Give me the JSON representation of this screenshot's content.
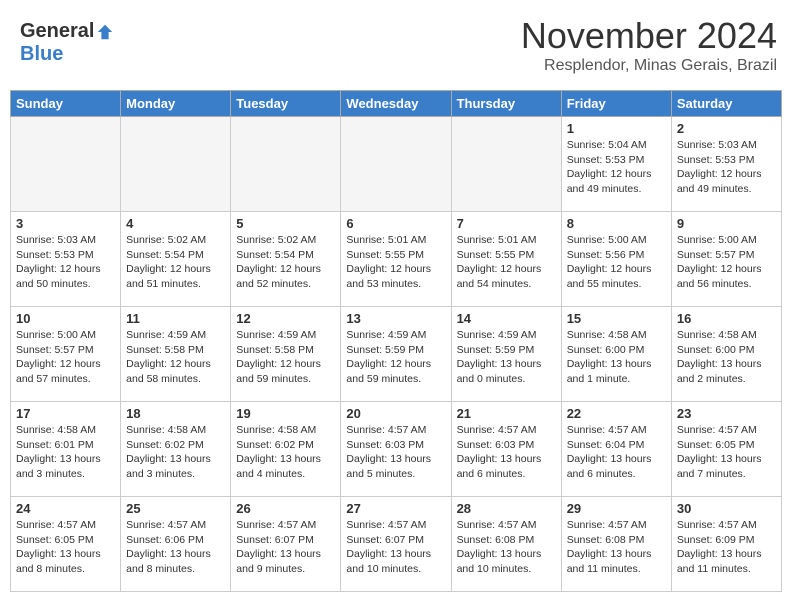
{
  "header": {
    "logo_general": "General",
    "logo_blue": "Blue",
    "month_title": "November 2024",
    "location": "Resplendor, Minas Gerais, Brazil"
  },
  "weekdays": [
    "Sunday",
    "Monday",
    "Tuesday",
    "Wednesday",
    "Thursday",
    "Friday",
    "Saturday"
  ],
  "weeks": [
    [
      {
        "day": "",
        "detail": ""
      },
      {
        "day": "",
        "detail": ""
      },
      {
        "day": "",
        "detail": ""
      },
      {
        "day": "",
        "detail": ""
      },
      {
        "day": "",
        "detail": ""
      },
      {
        "day": "1",
        "detail": "Sunrise: 5:04 AM\nSunset: 5:53 PM\nDaylight: 12 hours\nand 49 minutes."
      },
      {
        "day": "2",
        "detail": "Sunrise: 5:03 AM\nSunset: 5:53 PM\nDaylight: 12 hours\nand 49 minutes."
      }
    ],
    [
      {
        "day": "3",
        "detail": "Sunrise: 5:03 AM\nSunset: 5:53 PM\nDaylight: 12 hours\nand 50 minutes."
      },
      {
        "day": "4",
        "detail": "Sunrise: 5:02 AM\nSunset: 5:54 PM\nDaylight: 12 hours\nand 51 minutes."
      },
      {
        "day": "5",
        "detail": "Sunrise: 5:02 AM\nSunset: 5:54 PM\nDaylight: 12 hours\nand 52 minutes."
      },
      {
        "day": "6",
        "detail": "Sunrise: 5:01 AM\nSunset: 5:55 PM\nDaylight: 12 hours\nand 53 minutes."
      },
      {
        "day": "7",
        "detail": "Sunrise: 5:01 AM\nSunset: 5:55 PM\nDaylight: 12 hours\nand 54 minutes."
      },
      {
        "day": "8",
        "detail": "Sunrise: 5:00 AM\nSunset: 5:56 PM\nDaylight: 12 hours\nand 55 minutes."
      },
      {
        "day": "9",
        "detail": "Sunrise: 5:00 AM\nSunset: 5:57 PM\nDaylight: 12 hours\nand 56 minutes."
      }
    ],
    [
      {
        "day": "10",
        "detail": "Sunrise: 5:00 AM\nSunset: 5:57 PM\nDaylight: 12 hours\nand 57 minutes."
      },
      {
        "day": "11",
        "detail": "Sunrise: 4:59 AM\nSunset: 5:58 PM\nDaylight: 12 hours\nand 58 minutes."
      },
      {
        "day": "12",
        "detail": "Sunrise: 4:59 AM\nSunset: 5:58 PM\nDaylight: 12 hours\nand 59 minutes."
      },
      {
        "day": "13",
        "detail": "Sunrise: 4:59 AM\nSunset: 5:59 PM\nDaylight: 12 hours\nand 59 minutes."
      },
      {
        "day": "14",
        "detail": "Sunrise: 4:59 AM\nSunset: 5:59 PM\nDaylight: 13 hours\nand 0 minutes."
      },
      {
        "day": "15",
        "detail": "Sunrise: 4:58 AM\nSunset: 6:00 PM\nDaylight: 13 hours\nand 1 minute."
      },
      {
        "day": "16",
        "detail": "Sunrise: 4:58 AM\nSunset: 6:00 PM\nDaylight: 13 hours\nand 2 minutes."
      }
    ],
    [
      {
        "day": "17",
        "detail": "Sunrise: 4:58 AM\nSunset: 6:01 PM\nDaylight: 13 hours\nand 3 minutes."
      },
      {
        "day": "18",
        "detail": "Sunrise: 4:58 AM\nSunset: 6:02 PM\nDaylight: 13 hours\nand 3 minutes."
      },
      {
        "day": "19",
        "detail": "Sunrise: 4:58 AM\nSunset: 6:02 PM\nDaylight: 13 hours\nand 4 minutes."
      },
      {
        "day": "20",
        "detail": "Sunrise: 4:57 AM\nSunset: 6:03 PM\nDaylight: 13 hours\nand 5 minutes."
      },
      {
        "day": "21",
        "detail": "Sunrise: 4:57 AM\nSunset: 6:03 PM\nDaylight: 13 hours\nand 6 minutes."
      },
      {
        "day": "22",
        "detail": "Sunrise: 4:57 AM\nSunset: 6:04 PM\nDaylight: 13 hours\nand 6 minutes."
      },
      {
        "day": "23",
        "detail": "Sunrise: 4:57 AM\nSunset: 6:05 PM\nDaylight: 13 hours\nand 7 minutes."
      }
    ],
    [
      {
        "day": "24",
        "detail": "Sunrise: 4:57 AM\nSunset: 6:05 PM\nDaylight: 13 hours\nand 8 minutes."
      },
      {
        "day": "25",
        "detail": "Sunrise: 4:57 AM\nSunset: 6:06 PM\nDaylight: 13 hours\nand 8 minutes."
      },
      {
        "day": "26",
        "detail": "Sunrise: 4:57 AM\nSunset: 6:07 PM\nDaylight: 13 hours\nand 9 minutes."
      },
      {
        "day": "27",
        "detail": "Sunrise: 4:57 AM\nSunset: 6:07 PM\nDaylight: 13 hours\nand 10 minutes."
      },
      {
        "day": "28",
        "detail": "Sunrise: 4:57 AM\nSunset: 6:08 PM\nDaylight: 13 hours\nand 10 minutes."
      },
      {
        "day": "29",
        "detail": "Sunrise: 4:57 AM\nSunset: 6:08 PM\nDaylight: 13 hours\nand 11 minutes."
      },
      {
        "day": "30",
        "detail": "Sunrise: 4:57 AM\nSunset: 6:09 PM\nDaylight: 13 hours\nand 11 minutes."
      }
    ]
  ]
}
